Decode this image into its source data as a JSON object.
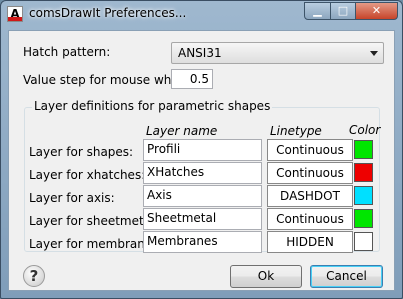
{
  "window": {
    "title": "comsDrawIt Preferences...",
    "app_icon_letter": "A"
  },
  "hatch_pattern": {
    "label": "Hatch pattern:",
    "value": "ANSI31"
  },
  "value_step": {
    "label": "Value step for mouse wheel:",
    "value": "0.5"
  },
  "group": {
    "title": "Layer definitions for parametric shapes",
    "headers": {
      "layer_name": "Layer name",
      "linetype": "Linetype",
      "color": "Color"
    },
    "rows": [
      {
        "label": "Layer for shapes:",
        "layer": "Profili",
        "linetype": "Continuous",
        "color": "#00e600"
      },
      {
        "label": "Layer for xhatches:",
        "layer": "XHatches",
        "linetype": "Continuous",
        "color": "#ee0000"
      },
      {
        "label": "Layer for axis:",
        "layer": "Axis",
        "linetype": "DASHDOT",
        "color": "#00e0ff"
      },
      {
        "label": "Layer for sheetmetal:",
        "layer": "Sheetmetal",
        "linetype": "Continuous",
        "color": "#00e600"
      },
      {
        "label": "Layer for membranes:",
        "layer": "Membranes",
        "linetype": "HIDDEN",
        "color": "#ffffff"
      }
    ]
  },
  "buttons": {
    "help": "?",
    "ok": "Ok",
    "cancel": "Cancel"
  },
  "colors": {
    "title_bar": "#8fabc6",
    "close_button": "#c7442a",
    "dialog_bg": "#f0f0f0"
  }
}
